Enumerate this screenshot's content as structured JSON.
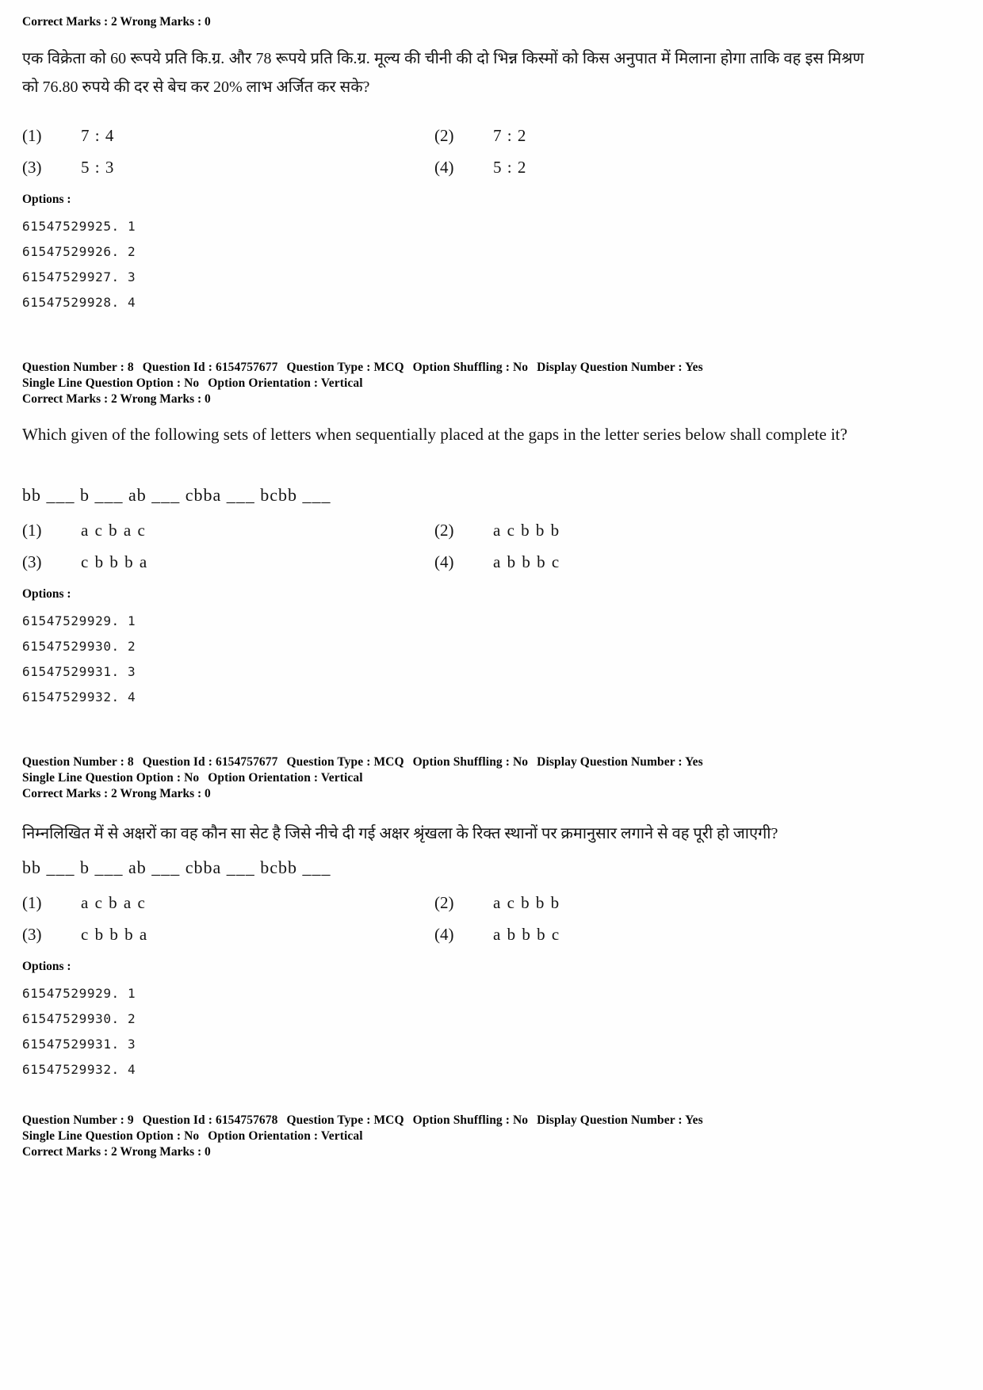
{
  "page": {
    "document_type": "exam-question-paper",
    "labels": {
      "options_label": "Options :",
      "correct_marks_prefix": "Correct Marks :",
      "wrong_marks_prefix": "Wrong Marks :",
      "question_number_prefix": "Question Number :",
      "question_id_prefix": "Question Id :",
      "question_type_prefix": "Question Type :",
      "option_shuffling_prefix": "Option Shuffling :",
      "display_question_number_prefix": "Display Question Number :",
      "single_line_question_option_prefix": "Single Line Question Option :",
      "option_orientation_prefix": "Option Orientation :"
    }
  },
  "blocks": [
    {
      "id": "q7-hindi",
      "marks": {
        "correct": "2",
        "wrong": "0"
      },
      "question_text": "एक विक्रेता को 60 रूपये प्रति कि.ग्र. और 78 रूपये प्रति कि.ग्र. मूल्य की चीनी की दो भिन्न किस्मों को किस अनुपात में मिलाना होगा ताकि वह इस मिश्रण को 76.80 रुपये की दर से बेच कर 20% लाभ अर्जित कर सके?",
      "choices": [
        {
          "num": "(1)",
          "value": "7 : 4"
        },
        {
          "num": "(2)",
          "value": "7 : 2"
        },
        {
          "num": "(3)",
          "value": "5 : 3"
        },
        {
          "num": "(4)",
          "value": "5 : 2"
        }
      ],
      "option_ids": [
        "61547529925. 1",
        "61547529926. 2",
        "61547529927. 3",
        "61547529928. 4"
      ]
    },
    {
      "id": "q8-english",
      "meta": {
        "question_number": "8",
        "question_id": "6154757677",
        "question_type": "MCQ",
        "option_shuffling": "No",
        "display_question_number": "Yes",
        "single_line_question_option": "No",
        "option_orientation": "Vertical"
      },
      "marks": {
        "correct": "2",
        "wrong": "0"
      },
      "question_text": "Which given of the following sets of letters when sequentially placed at the gaps in the letter series below shall complete it?",
      "series": "bb ___ b ___ ab ___ cbba ___ bcbb ___",
      "choices": [
        {
          "num": "(1)",
          "value": "a c b a c"
        },
        {
          "num": "(2)",
          "value": "a c b b b"
        },
        {
          "num": "(3)",
          "value": "c b b b a"
        },
        {
          "num": "(4)",
          "value": "a b b b c"
        }
      ],
      "option_ids": [
        "61547529929. 1",
        "61547529930. 2",
        "61547529931. 3",
        "61547529932. 4"
      ]
    },
    {
      "id": "q8-hindi",
      "meta": {
        "question_number": "8",
        "question_id": "6154757677",
        "question_type": "MCQ",
        "option_shuffling": "No",
        "display_question_number": "Yes",
        "single_line_question_option": "No",
        "option_orientation": "Vertical"
      },
      "marks": {
        "correct": "2",
        "wrong": "0"
      },
      "question_text": "निम्नलिखित में से अक्षरों का वह कौन सा सेट है जिसे नीचे दी गई अक्षर श्रृंखला के रिक्त स्थानों पर क्रमानुसार लगाने से वह पूरी हो जाएगी?",
      "series": "bb ___ b ___ ab ___ cbba ___ bcbb ___",
      "choices": [
        {
          "num": "(1)",
          "value": "a c b a c"
        },
        {
          "num": "(2)",
          "value": "a c b b b"
        },
        {
          "num": "(3)",
          "value": "c b b b a"
        },
        {
          "num": "(4)",
          "value": "a b b b c"
        }
      ],
      "option_ids": [
        "61547529929. 1",
        "61547529930. 2",
        "61547529931. 3",
        "61547529932. 4"
      ]
    },
    {
      "id": "q9-header",
      "meta": {
        "question_number": "9",
        "question_id": "6154757678",
        "question_type": "MCQ",
        "option_shuffling": "No",
        "display_question_number": "Yes",
        "single_line_question_option": "No",
        "option_orientation": "Vertical"
      },
      "marks": {
        "correct": "2",
        "wrong": "0"
      }
    }
  ]
}
